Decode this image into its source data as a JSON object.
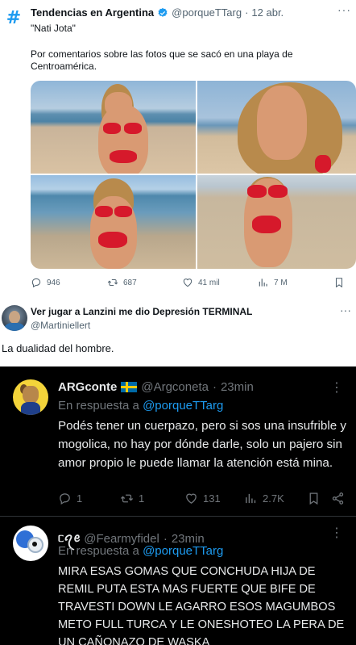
{
  "tweet1": {
    "icon_glyph": "#",
    "name": "Tendencias en Argentina",
    "handle": "@porqueTTarg",
    "separator": "·",
    "time": "12 abr.",
    "more": "···",
    "text_line1": "\"Nati Jota\"",
    "text_line2": "Por comentarios sobre las fotos que se sacó en una playa de Centroamérica.",
    "actions": {
      "replies": "946",
      "retweets": "687",
      "likes": "41 mil",
      "views": "7 M"
    }
  },
  "tweet2": {
    "name": "Ver jugar a Lanzini me dio Depresión TERMINAL",
    "handle": "@Martiniellert",
    "more": "···",
    "text": "La dualidad del hombre."
  },
  "embedded": {
    "reply1": {
      "name": "ARGconte",
      "handle": "@Argconeta",
      "separator": "·",
      "time": "23min",
      "more": "⋮",
      "in_reply_prefix": "En respuesta a",
      "in_reply_mention": "@porqueTTarg",
      "text": "Podés tener un cuerpazo, pero si sos una insufrible y mogolica, no hay por dónde darle, solo un pajero sin amor propio le puede llamar la atención está mina.",
      "actions": {
        "replies": "1",
        "retweets": "1",
        "likes": "131",
        "views": "2.7K"
      }
    },
    "reply2": {
      "name": "ᥴꪖꫀ",
      "handle": "@Fearmyfidel",
      "separator": "·",
      "time": "23min",
      "more": "⋮",
      "in_reply_prefix": "En respuesta a",
      "in_reply_mention": "@porqueTTarg",
      "text": "MIRA ESAS GOMAS QUE CONCHUDA HIJA DE REMIL PUTA ESTA MAS FUERTE QUE BIFE DE TRAVESTI DOWN LE AGARRO ESOS MAGUMBOS METO FULL TURCA Y LE ONESHOTEO LA PERA DE UN CAÑONAZO DE WASKA"
    }
  },
  "colors": {
    "accent": "#1d9bf0",
    "secondary_text_light": "#536471",
    "secondary_text_dark": "#71767b",
    "dark_bg": "#000000"
  }
}
